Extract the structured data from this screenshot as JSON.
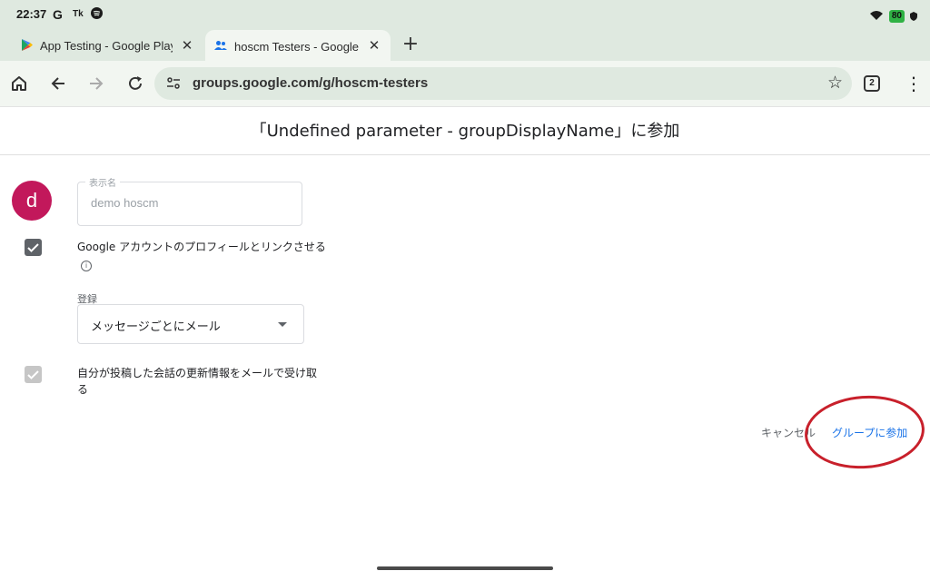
{
  "status_bar": {
    "time": "22:37",
    "icons": [
      "google-g-icon",
      "tk-icon",
      "spotify-icon"
    ],
    "battery": "80"
  },
  "tabs": [
    {
      "title": "App Testing - Google Play",
      "icon": "google-play-icon",
      "active": false
    },
    {
      "title": "hoscm Testers - Google グ",
      "icon": "groups-icon",
      "active": true
    }
  ],
  "toolbar": {
    "url": "groups.google.com/g/hoscm-testers",
    "tab_count": "2"
  },
  "page": {
    "title": "「Undefined parameter - groupDisplayName」に参加",
    "avatar_letter": "d",
    "display_name_label": "表示名",
    "display_name_value": "demo hoscm",
    "link_profile_label": "Google アカウントのプロフィールとリンクさせる",
    "subscription_label": "登録",
    "subscription_value": "メッセージごとにメール",
    "email_updates_label": "自分が投稿した会話の更新情報をメールで受け取る",
    "cancel_label": "キャンセル",
    "join_label": "グループに参加"
  },
  "colors": {
    "avatar": "#c2185b",
    "link_blue": "#1a73e8",
    "annotation_red": "#c8202b",
    "chrome_bg": "#dfe9e0"
  }
}
